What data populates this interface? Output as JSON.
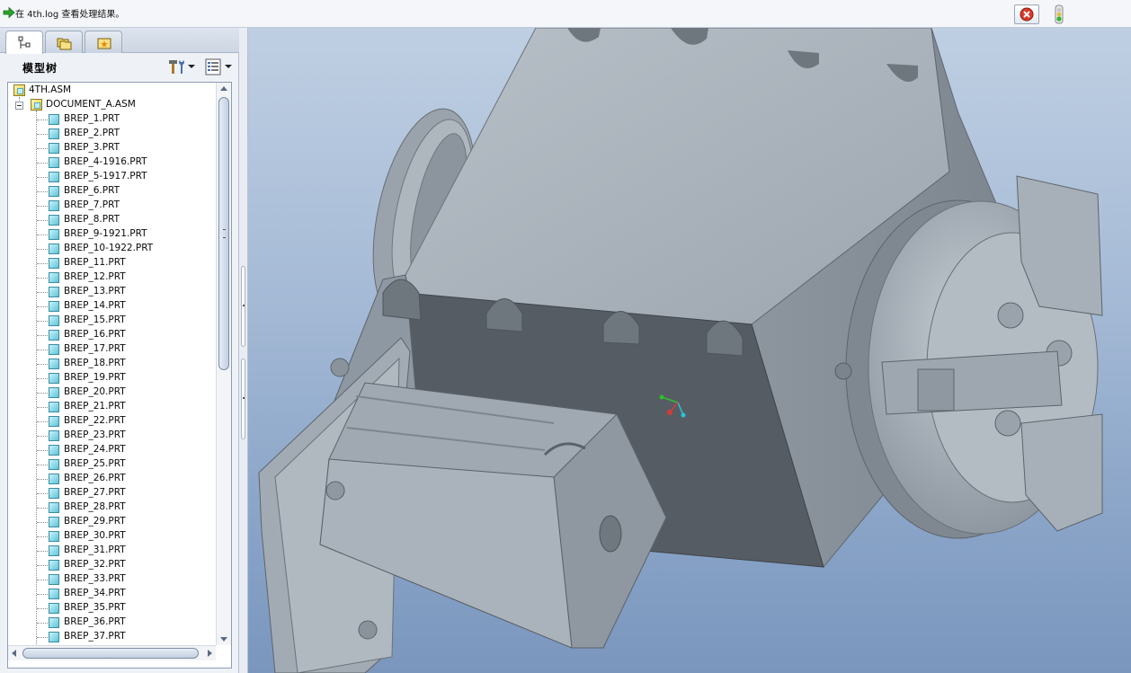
{
  "message_bar": {
    "text": "在 4th.log 查看处理结果。",
    "colors": {
      "arrow": "#2aa52a",
      "stop": "#d83a2a",
      "light_green": "#2fb52f"
    }
  },
  "left_panel": {
    "tabs": [
      {
        "icon": "model-tree-icon",
        "active": true
      },
      {
        "icon": "folder-browser-icon",
        "active": false
      },
      {
        "icon": "favorites-icon",
        "active": false
      }
    ],
    "tree_title": "模型树",
    "tree": {
      "root": "4TH.ASM",
      "sub_assembly": "DOCUMENT_A.ASM",
      "parts": [
        "BREP_1.PRT",
        "BREP_2.PRT",
        "BREP_3.PRT",
        "BREP_4-1916.PRT",
        "BREP_5-1917.PRT",
        "BREP_6.PRT",
        "BREP_7.PRT",
        "BREP_8.PRT",
        "BREP_9-1921.PRT",
        "BREP_10-1922.PRT",
        "BREP_11.PRT",
        "BREP_12.PRT",
        "BREP_13.PRT",
        "BREP_14.PRT",
        "BREP_15.PRT",
        "BREP_16.PRT",
        "BREP_17.PRT",
        "BREP_18.PRT",
        "BREP_19.PRT",
        "BREP_20.PRT",
        "BREP_21.PRT",
        "BREP_22.PRT",
        "BREP_23.PRT",
        "BREP_24.PRT",
        "BREP_25.PRT",
        "BREP_26.PRT",
        "BREP_27.PRT",
        "BREP_28.PRT",
        "BREP_29.PRT",
        "BREP_30.PRT",
        "BREP_31.PRT",
        "BREP_32.PRT",
        "BREP_33.PRT",
        "BREP_34.PRT",
        "BREP_35.PRT",
        "BREP_36.PRT",
        "BREP_37.PRT"
      ]
    }
  },
  "viewport": {
    "colors": {
      "bg_top": "#bfcfe3",
      "bg_bottom": "#7b96bd",
      "metal_light": "#aab3bc",
      "metal_mid": "#8e98a2",
      "metal_dark": "#565c63"
    }
  }
}
